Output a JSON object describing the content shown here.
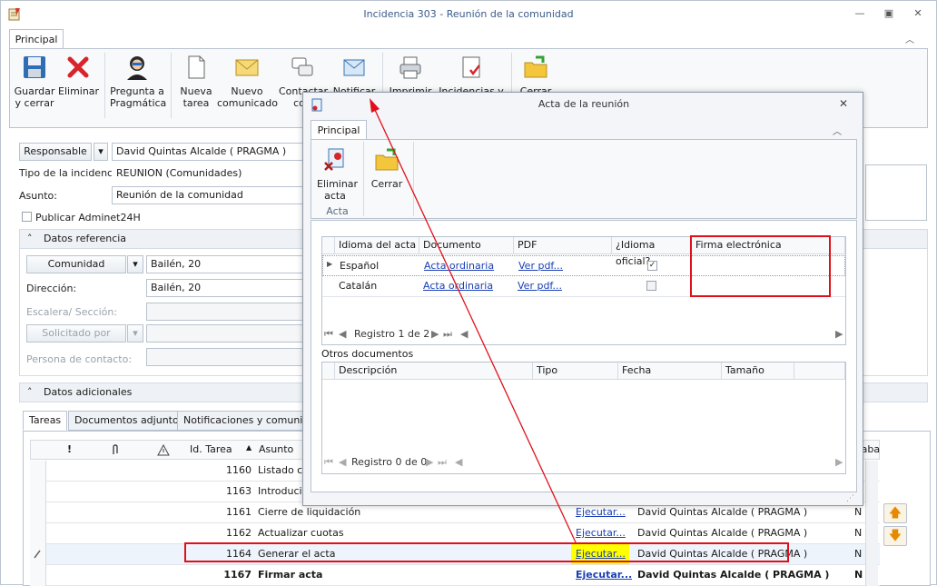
{
  "window": {
    "title": "Incidencia 303 - Reunión de la comunidad"
  },
  "ribbon": {
    "tab": "Principal",
    "buttons": {
      "save_close": "Guardar\ny cerrar",
      "delete": "Eliminar",
      "ask": "Pregunta a\nPragmática",
      "new_task": "Nueva\ntarea",
      "new_notice": "Nuevo\ncomunicado",
      "contact": "Contactar\ncon",
      "notify": "Notificar",
      "print": "Imprimir",
      "incidents": "Incidencias y",
      "close": "Cerrar"
    }
  },
  "form": {
    "responsible_btn": "Responsable",
    "responsible_value": "David Quintas Alcalde ( PRAGMA )",
    "type_label": "Tipo de la incidencia:",
    "type_value": "REUNION (Comunidades)",
    "subject_label": "Asunto:",
    "subject_value": "Reunión de la comunidad",
    "publish_label": "Publicar Adminet24H",
    "ref_section": "Datos referencia",
    "community_btn": "Comunidad",
    "community_value": "Bailén, 20",
    "address_label": "Dirección:",
    "address_value": "Bailén, 20",
    "stair_label": "Escalera/ Sección:",
    "requested_btn": "Solicitado por",
    "contact_label": "Persona de contacto:",
    "extra_section": "Datos adicionales"
  },
  "tabs": [
    "Tareas",
    "Documentos adjuntos",
    "Notificaciones y comunicado"
  ],
  "tasks": {
    "headers": {
      "id": "Id. Tarea",
      "subject": "Asunto",
      "trab": "Trabaj"
    },
    "header_icons": {
      "excl": "!",
      "clip": "clip-icon",
      "warn": "warning-icon"
    },
    "rows": [
      {
        "id": "1160",
        "subject": "Listado cor",
        "action": "",
        "user": "",
        "n": ""
      },
      {
        "id": "1163",
        "subject": "Introducir",
        "action": "",
        "user": "",
        "n": ""
      },
      {
        "id": "1161",
        "subject": "Cierre de liquidación",
        "action": "Ejecutar...",
        "user": "David Quintas Alcalde ( PRAGMA )",
        "n": "N"
      },
      {
        "id": "1162",
        "subject": "Actualizar cuotas",
        "action": "Ejecutar...",
        "user": "David Quintas Alcalde ( PRAGMA )",
        "n": "N"
      },
      {
        "id": "1164",
        "subject": "Generar el acta",
        "action": "Ejecutar...",
        "user": "David Quintas Alcalde ( PRAGMA )",
        "n": "N"
      },
      {
        "id": "1167",
        "subject": "Firmar acta",
        "action": "Ejecutar...",
        "user": "David Quintas Alcalde ( PRAGMA )",
        "n": "N"
      }
    ]
  },
  "dialog": {
    "title": "Acta de la reunión",
    "tab": "Principal",
    "group_label": "Acta",
    "btn_delete": "Eliminar\nacta",
    "btn_close": "Cerrar",
    "grid1": {
      "headers": [
        "Idioma del acta",
        "Documento",
        "PDF",
        "¿Idioma oficial?",
        "Firma electrónica"
      ],
      "rows": [
        {
          "lang": "Español",
          "doc": "Acta ordinaria",
          "pdf": "Ver pdf...",
          "official": true
        },
        {
          "lang": "Catalán",
          "doc": "Acta ordinaria",
          "pdf": "Ver pdf...",
          "official": false
        }
      ],
      "nav": "Registro 1 de 2"
    },
    "other_docs_label": "Otros documentos",
    "grid2": {
      "headers": [
        "Descripción",
        "Tipo",
        "Fecha",
        "Tamaño"
      ],
      "nav": "Registro 0 de 0"
    }
  },
  "colors": {
    "highlight_red": "#e0101b",
    "yellow": "#ffff00",
    "link": "#1a3fb5"
  }
}
